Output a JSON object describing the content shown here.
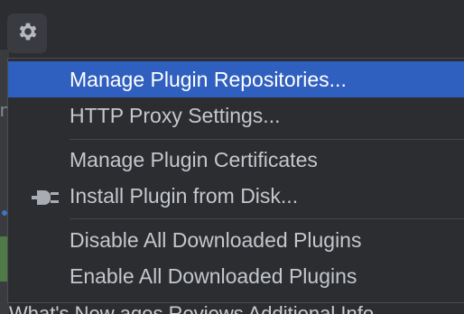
{
  "toolbar": {
    "gear_icon": "gear-icon"
  },
  "menu": {
    "items": [
      {
        "label": "Manage Plugin Repositories...",
        "selected": true
      },
      {
        "label": "HTTP Proxy Settings..."
      },
      {
        "label": "Manage Plugin Certificates"
      },
      {
        "label": "Install Plugin from Disk...",
        "icon": "plug-icon"
      },
      {
        "label": "Disable All Downloaded Plugins"
      },
      {
        "label": "Enable All Downloaded Plugins"
      }
    ]
  },
  "background": {
    "left_fragment": "n",
    "bottom_fragment": "What's New   ages   Reviews   Additional Info"
  },
  "colors": {
    "selection": "#2f5fbf",
    "popup_bg": "#2b2d30",
    "text": "#c4c7cc",
    "accent_green": "#4e7a45"
  }
}
